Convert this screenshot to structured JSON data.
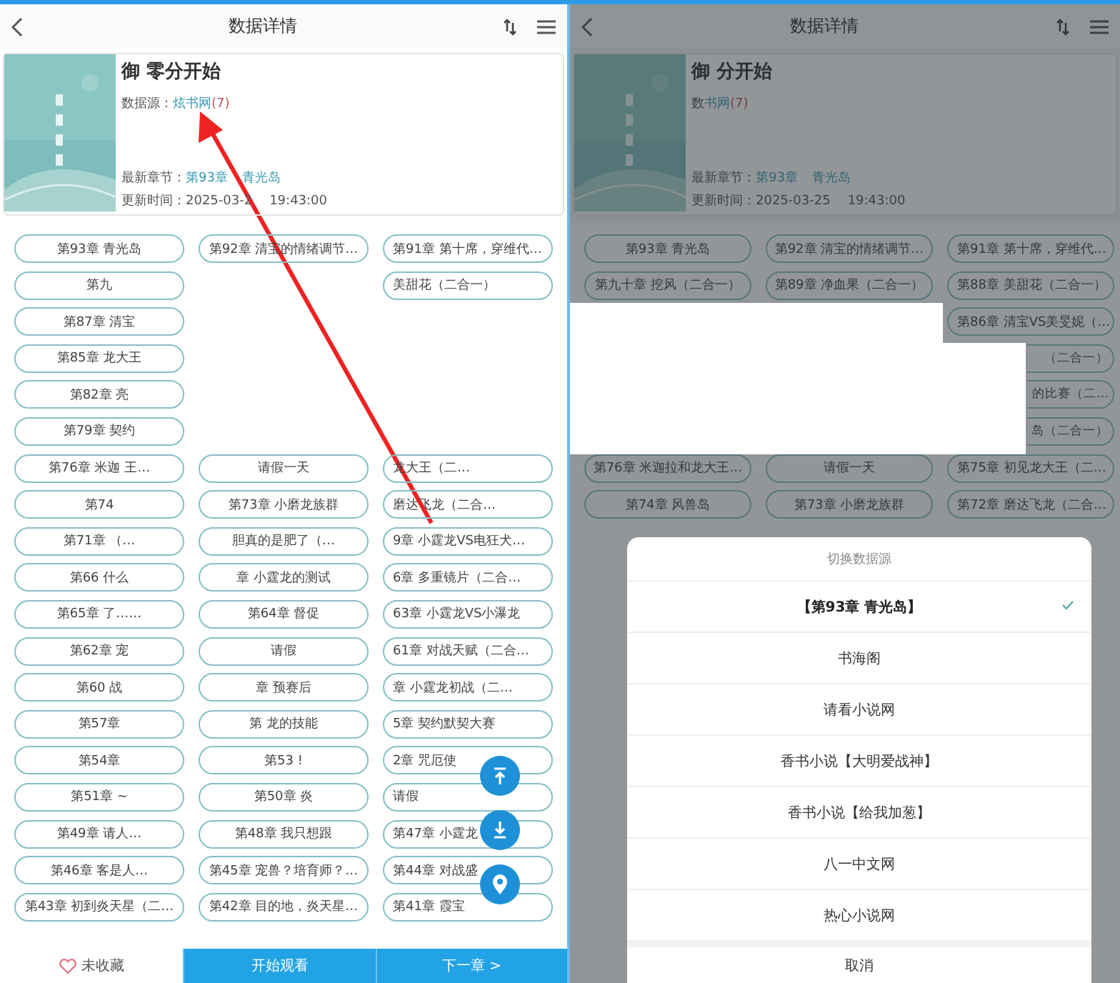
{
  "panels": [
    {
      "kind": "main",
      "nav": {
        "title": "数据详情"
      },
      "book": {
        "title": "御 零分开始",
        "source_label": "数据源：",
        "source_name": "炫书网",
        "source_count": "(7)",
        "latest_label": "最新章节：",
        "latest_chapter": "第93章 青光岛",
        "updated_label": "更新时间：",
        "updated_date": "2025-03-2",
        "updated_clock": "19:43:00"
      },
      "chapters": [
        {
          "kind": "full",
          "left": "第93章 青光岛",
          "middle": "第92章 清宝的情绪调节…",
          "right": "第91章 第十席，穿维代…"
        },
        {
          "kind": "full",
          "left": "第九",
          "right": "美甜花（二合一）"
        },
        {
          "kind": "full",
          "left": "第87章 清宝"
        },
        {
          "kind": "full",
          "left": "第85章 龙大王"
        },
        {
          "kind": "full",
          "left": "第82章 亮"
        },
        {
          "kind": "full",
          "left": "第79章 契约"
        },
        {
          "kind": "full",
          "left": "第76章 米迦 王…",
          "middle": "请假一天",
          "right": "龙大王（二…"
        },
        {
          "kind": "full",
          "left": "第74",
          "middle": "第73章 小磨龙族群",
          "right": "磨达飞龙（二合…"
        },
        {
          "kind": "full",
          "left": "第71章 （…",
          "middle": "胆真的是肥了（…",
          "right": "9章 小霆龙VS电狂犬…"
        },
        {
          "kind": "full",
          "left": "第66 什么",
          "middle": "章 小霆龙的测试",
          "right": "6章 多重镜片（二合…"
        },
        {
          "kind": "full",
          "left": "第65章 了……",
          "middle": "第64章 督促",
          "right": "63章 小霆龙VS小瀑龙"
        },
        {
          "kind": "full",
          "left": "第62章 宠",
          "middle": "请假",
          "right": "61章 对战天赋（二合…"
        },
        {
          "kind": "full",
          "left": "第60 战",
          "middle": "章 预赛后",
          "right": "章 小霆龙初战（二…"
        },
        {
          "kind": "full",
          "left": "第57章",
          "middle": "第 龙的技能",
          "right": "5章 契约默契大赛"
        },
        {
          "kind": "full",
          "left": "第54章",
          "middle": "第53 !",
          "right": "2章 咒厄使"
        },
        {
          "kind": "full",
          "left": "第51章 ~",
          "middle": "第50章 炎",
          "right": "请假"
        },
        {
          "kind": "full",
          "left": "第49章 请人…",
          "middle": "第48章 我只想跟",
          "right": "第47章 小霆龙"
        },
        {
          "kind": "full",
          "left": "第46章 客是人…",
          "middle": "第45章 宠兽？培育师？…",
          "right": "第44章 对战盛"
        },
        {
          "kind": "full",
          "left": "第43章 初到炎天星（二…",
          "middle": "第42章 目的地，炎天星…",
          "right": "第41章 霞宝"
        }
      ],
      "float_buttons": [
        {
          "kind": "top"
        },
        {
          "kind": "bottom"
        },
        {
          "kind": "locate"
        }
      ],
      "bottom_bar": {
        "favorite": {
          "label": "未收藏",
          "on": false
        },
        "start": "开始观看",
        "next": "下一章 >"
      }
    },
    {
      "kind": "dimmed",
      "nav": {
        "title": "数据详情"
      },
      "book": {
        "title": "御 分开始",
        "source_label": "数",
        "source_name": "书网",
        "source_count": "(7)",
        "latest_label": "最新章节：",
        "latest_chapter": "第93章 青光岛",
        "updated_label": "更新时间：",
        "updated_date": "2025-03-25",
        "updated_clock": "19:43:00"
      },
      "chapters": [
        {
          "kind": "full",
          "left": "第93章 青光岛",
          "middle": "第92章 清宝的情绪调节…",
          "right": "第91章 第十席，穿维代…"
        },
        {
          "kind": "full",
          "left": "第九十章 挖风（二合一）",
          "middle": "第89章 净血果（二合一）",
          "right": "第88章 美甜花（二合一）"
        },
        {
          "kind": "full",
          "right": "第86章 清宝VS美旻妮（…"
        },
        {
          "kind": "cut",
          "right": "（二合一）"
        },
        {
          "kind": "cut",
          "right": "的比赛（二…"
        },
        {
          "kind": "cut",
          "right": "岛（二合一）"
        },
        {
          "kind": "full",
          "left": "第76章 米迦拉和龙大王…",
          "middle": "请假一天",
          "right": "第75章 初见龙大王（二…"
        },
        {
          "kind": "full",
          "left": "第74章 风兽岛",
          "middle": "第73章 小磨龙族群",
          "right": "第72章 磨达飞龙（二合…"
        }
      ],
      "dialog": {
        "title": "切换数据源",
        "options": [
          {
            "label": "【第93章 青光岛】",
            "selected": true
          },
          {
            "label": "书海阁",
            "selected": false
          },
          {
            "label": "请看小说网",
            "selected": false
          },
          {
            "label": "香书小说【大明爱战神】",
            "selected": false
          },
          {
            "label": "香书小说【给我加葱】",
            "selected": false
          },
          {
            "label": "八一中文网",
            "selected": false
          },
          {
            "label": "热心小说网",
            "selected": false
          }
        ],
        "cancel": "取消"
      }
    }
  ]
}
